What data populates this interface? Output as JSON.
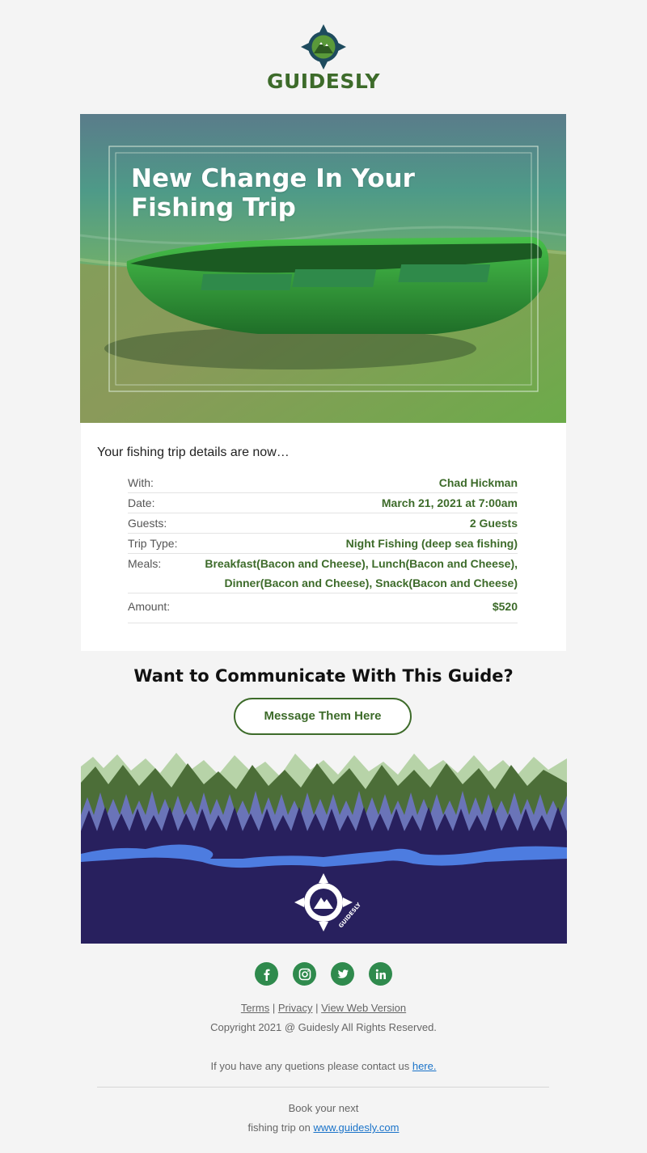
{
  "brand": {
    "name": "GUIDESLY",
    "footer_logo_text": "GUIDESLY",
    "colors": {
      "primary_green": "#3d6b2a",
      "social_green": "#2f8a4d",
      "navy": "#28205e",
      "link_blue": "#1a73c9"
    }
  },
  "hero": {
    "title": "New Change In Your Fishing Trip"
  },
  "details": {
    "intro": "Your fishing trip details are now…",
    "rows": [
      {
        "label": "With:",
        "value": "Chad Hickman"
      },
      {
        "label": "Date:",
        "value": "March 21, 2021 at 7:00am"
      },
      {
        "label": "Guests:",
        "value": "2 Guests"
      },
      {
        "label": "Trip Type:",
        "value": "Night Fishing (deep sea fishing)"
      },
      {
        "label": "Meals:",
        "value": "Breakfast(Bacon and Cheese), Lunch(Bacon and Cheese), Dinner(Bacon and Cheese), Snack(Bacon and Cheese)"
      },
      {
        "label": "Amount:",
        "value": "$520"
      }
    ]
  },
  "cta": {
    "title": "Want to Communicate With This Guide?",
    "button_label": "Message Them Here"
  },
  "socials": [
    "facebook-icon",
    "instagram-icon",
    "twitter-icon",
    "linkedin-icon"
  ],
  "footer": {
    "terms": "Terms",
    "privacy": "Privacy",
    "web_version": "View Web Version",
    "separator": "|",
    "copyright": "Copyright 2021 @ Guidesly All Rights Reserved.",
    "contact_text": "If you have any quetions please contact us",
    "contact_link": "here.",
    "book_line1": "Book your next",
    "book_line2": "fishing trip on",
    "book_link": "www.guidesly.com"
  }
}
